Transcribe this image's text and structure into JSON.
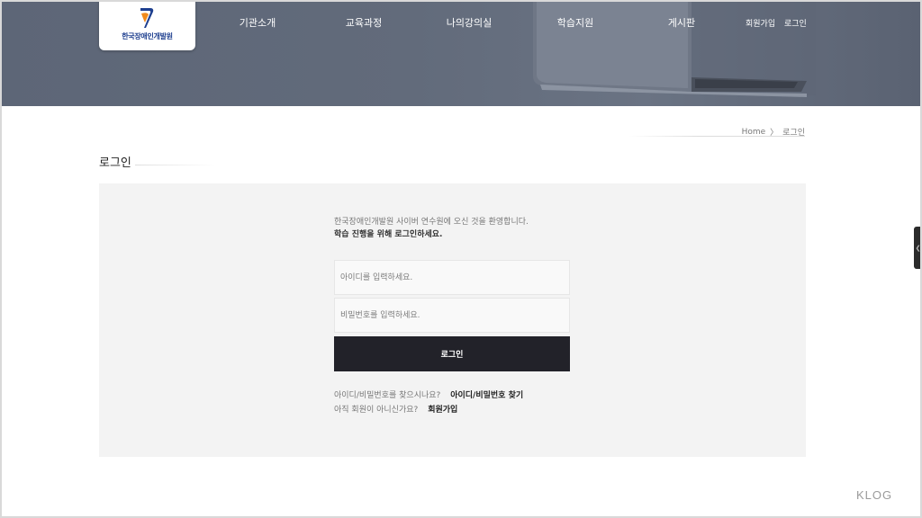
{
  "header": {
    "logo_text": "한국장애인개발원",
    "nav": [
      {
        "label": "기관소개"
      },
      {
        "label": "교육과정"
      },
      {
        "label": "나의강의실"
      },
      {
        "label": "학습지원"
      },
      {
        "label": "게시판"
      }
    ],
    "util": {
      "join": "회원가입",
      "login": "로그인"
    }
  },
  "breadcrumb": {
    "home": "Home",
    "separator": "〉",
    "current": "로그인"
  },
  "page_title": "로그인",
  "login": {
    "welcome_line1": "한국장애인개발원 사이버 연수원에 오신 것을 환영합니다.",
    "welcome_line2": "학습 진행을 위해 로그인하세요.",
    "id_placeholder": "아이디를 입력하세요.",
    "id_value": "",
    "pw_placeholder": "비밀번호를 입력하세요.",
    "pw_value": "",
    "button_label": "로그인",
    "find_question": "아이디/비밀번호를 찾으시나요?",
    "find_link": "아이디/비밀번호 찾기",
    "join_question": "아직 회원이 아니신가요?",
    "join_link": "회원가입"
  },
  "watermark": "KLOG",
  "colors": {
    "header_bg": "#626b7b",
    "button_bg": "#222229",
    "panel_bg": "#f3f3f3",
    "logo_blue": "#1e3f8f",
    "logo_orange": "#f08a1c"
  },
  "icons": {
    "side_tab": "chevron-icon"
  }
}
